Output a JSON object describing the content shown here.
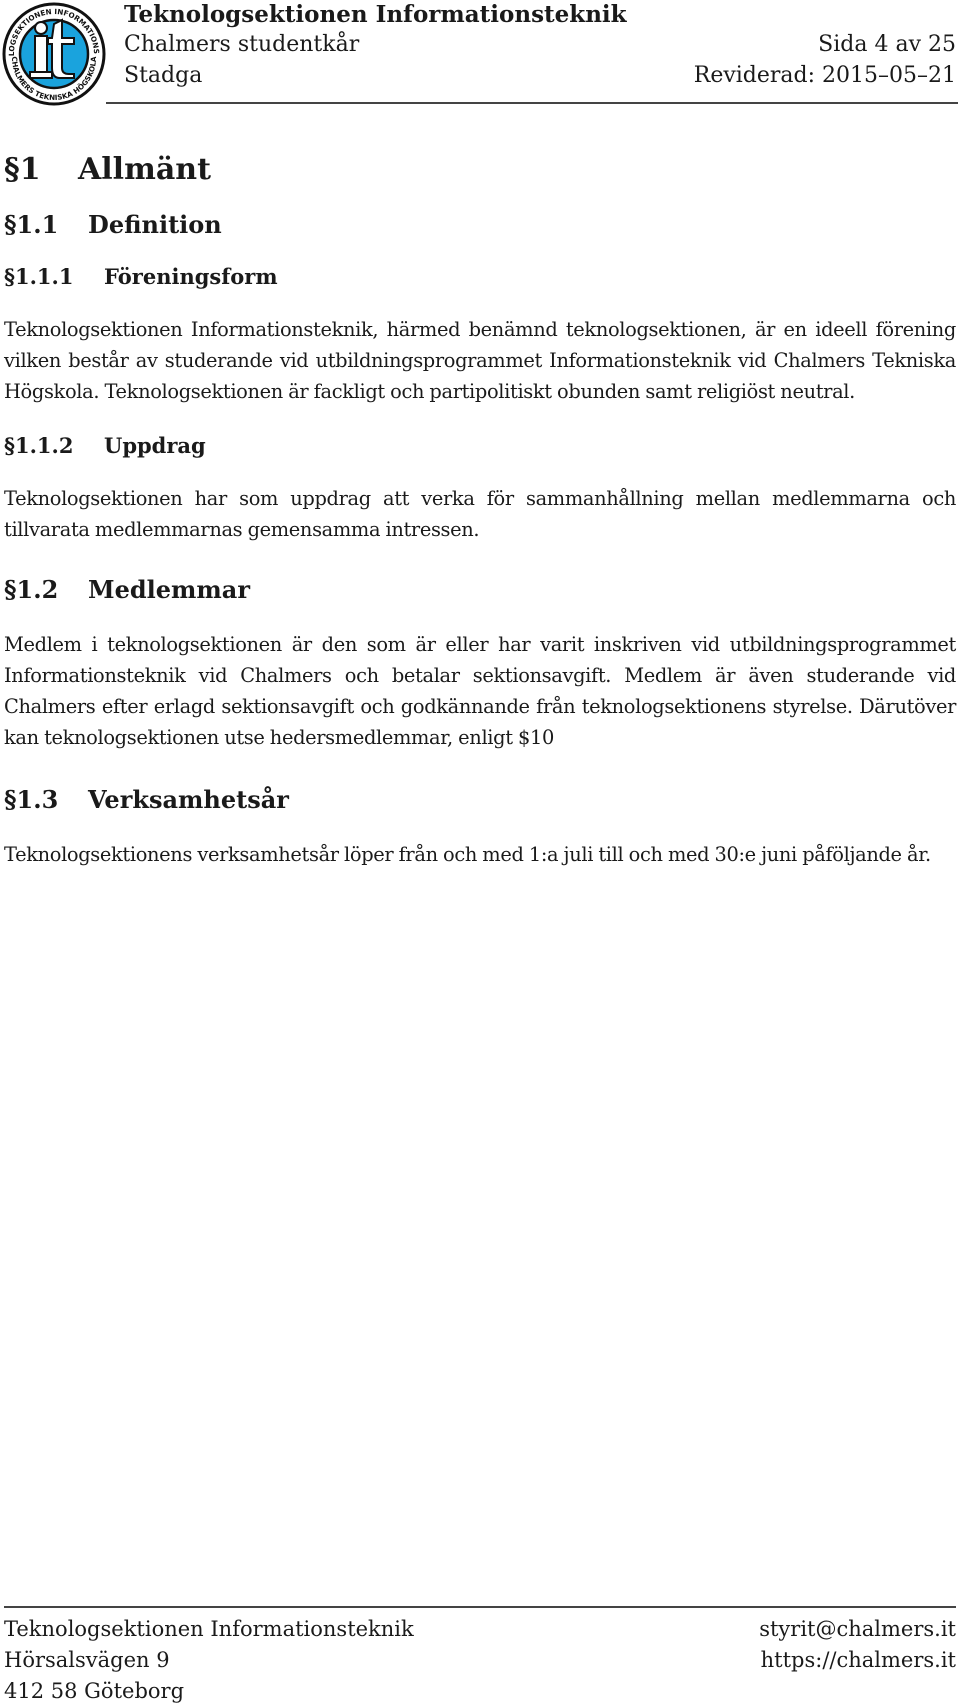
{
  "header": {
    "logo": "it-section-logo",
    "logo_ring_text_top": "TEKNOLOGSEKTIONEN INFORMATIONSTEKNIK",
    "logo_ring_text_bottom": "CHALMERS TEKNISKA HÖGSKOLA",
    "logo_color": "#1aa3dd",
    "title": "Teknologsektionen Informationsteknik",
    "organization": "Chalmers studentkår",
    "document_type": "Stadga",
    "page": "Sida 4 av 25",
    "revised": "Reviderad: 2015–05–21"
  },
  "sections": {
    "s1": {
      "num": "§1",
      "title": "Allmänt"
    },
    "s1_1": {
      "num": "§1.1",
      "title": "Definition"
    },
    "s1_1_1": {
      "num": "§1.1.1",
      "title": "Föreningsform",
      "text": "Teknologsektionen Informationsteknik, härmed benämnd teknologsektionen, är en ideell förening vilken består av studerande vid utbildningsprogrammet Informationsteknik vid Chalmers Tekniska Högskola. Teknologsektionen är fackligt och partipolitiskt obunden samt religiöst neutral."
    },
    "s1_1_2": {
      "num": "§1.1.2",
      "title": "Uppdrag",
      "text": "Teknologsektionen har som uppdrag att verka för sammanhållning mellan medlemmarna och tillvarata medlemmarnas gemensamma intressen."
    },
    "s1_2": {
      "num": "§1.2",
      "title": "Medlemmar",
      "text": "Medlem i teknologsektionen är den som är eller har varit inskriven vid utbildningsprogrammet Informationsteknik vid Chalmers och betalar sektionsavgift. Medlem är även studerande vid Chalmers efter erlagd sektionsavgift och godkännande från teknologsektionens styrelse. Därutöver kan teknologsektionen utse hedersmedlemmar, enligt $10"
    },
    "s1_3": {
      "num": "§1.3",
      "title": "Verksamhetsår",
      "text": "Teknologsektionens verksamhetsår löper från och med 1:a juli till och med 30:e juni påföljande år."
    }
  },
  "footer": {
    "org_name": "Teknologsektionen Informationsteknik",
    "street": "Hörsalsvägen 9",
    "city": "412 58 Göteborg",
    "email": "styrit@chalmers.it",
    "website": "https://chalmers.it"
  }
}
